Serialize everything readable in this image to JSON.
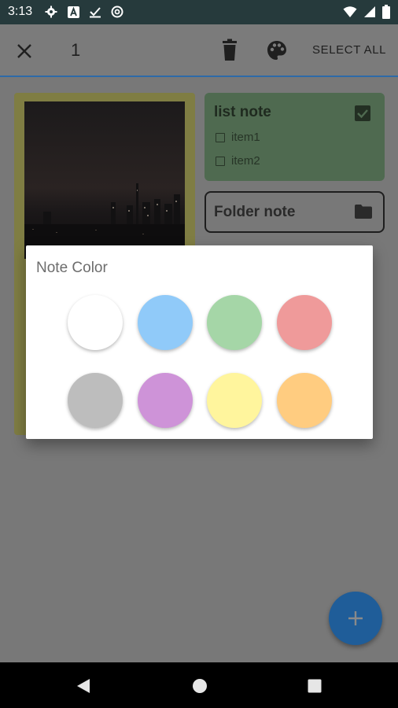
{
  "status_bar": {
    "time": "3:13",
    "left_icons": [
      "gear-icon",
      "a-square-icon",
      "download-check-icon",
      "at-circle-icon"
    ],
    "right_icons": [
      "wifi-icon",
      "cell-signal-icon",
      "battery-icon"
    ]
  },
  "app_bar": {
    "selected_count": "1",
    "select_all_label": "SELECT ALL"
  },
  "notes": {
    "list_note": {
      "title": "list note",
      "items": [
        "item1",
        "item2"
      ]
    },
    "folder_note": {
      "title": "Folder note"
    }
  },
  "dialog": {
    "title": "Note Color",
    "colors": [
      {
        "name": "white",
        "hex": "#ffffff"
      },
      {
        "name": "blue",
        "hex": "#90caf9"
      },
      {
        "name": "green",
        "hex": "#a5d6a7"
      },
      {
        "name": "red",
        "hex": "#ef9a9a"
      },
      {
        "name": "gray",
        "hex": "#bdbdbd"
      },
      {
        "name": "purple",
        "hex": "#ce93d8"
      },
      {
        "name": "yellow",
        "hex": "#fff59d"
      },
      {
        "name": "orange",
        "hex": "#ffcc80"
      }
    ]
  },
  "fab": {
    "icon": "plus-icon"
  },
  "nav_bar": {
    "icons": [
      "back-icon",
      "home-icon",
      "recents-icon"
    ]
  }
}
